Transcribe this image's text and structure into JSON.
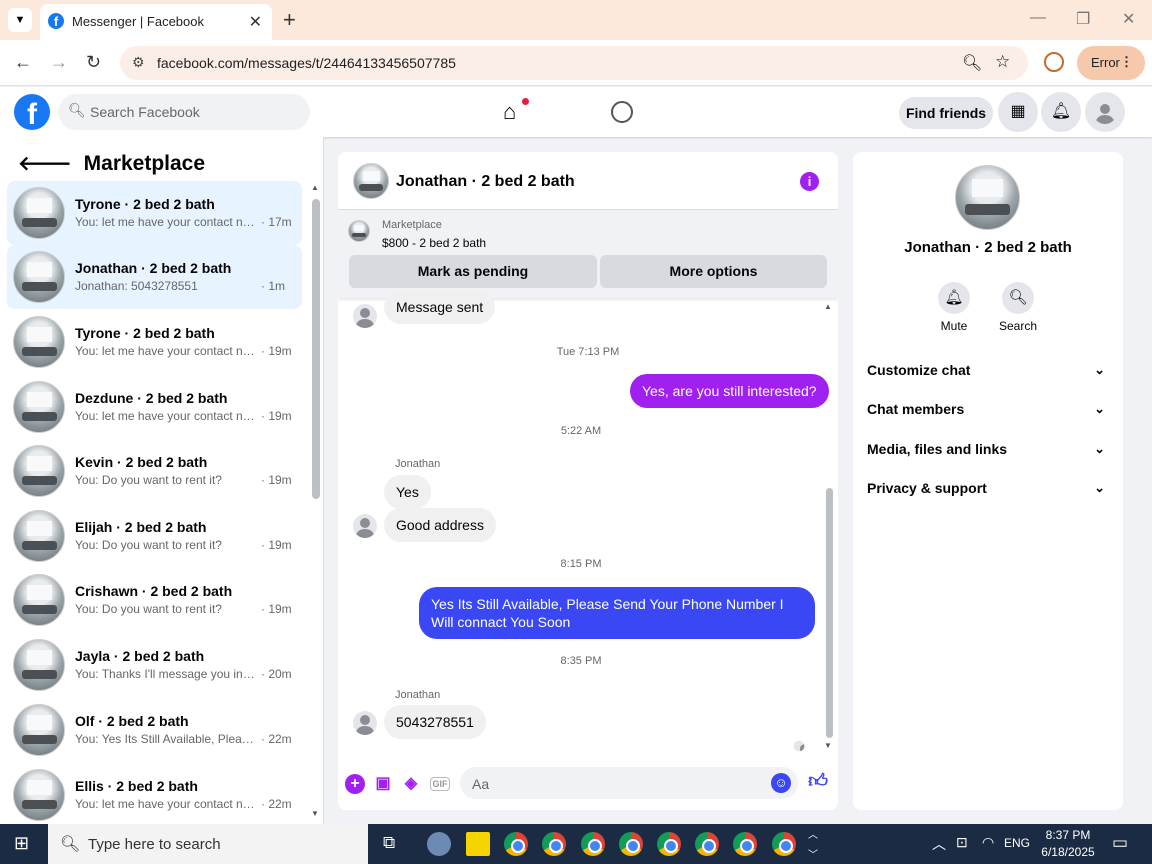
{
  "browser": {
    "tab_title": "Messenger | Facebook",
    "url": "facebook.com/messages/t/24464133456507785",
    "profile_button": "Error"
  },
  "facebook": {
    "search_placeholder": "Search Facebook",
    "find_friends": "Find friends"
  },
  "sidebar": {
    "title": "Marketplace",
    "conversations": [
      {
        "name": "Tyrone · 2 bed 2 bath",
        "snippet": "You: let me have your contact nu...",
        "time": "· 17m",
        "selected": true
      },
      {
        "name": "Jonathan · 2 bed 2 bath",
        "snippet": "Jonathan: 5043278551",
        "time": "· 1m",
        "selected": true
      },
      {
        "name": "Tyrone · 2 bed 2 bath",
        "snippet": "You: let me have your contact nu...",
        "time": "· 19m",
        "selected": false
      },
      {
        "name": "Dezdune · 2 bed 2 bath",
        "snippet": "You: let me have your contact nu...",
        "time": "· 19m",
        "selected": false
      },
      {
        "name": "Kevin · 2 bed 2 bath",
        "snippet": "You: Do you want to rent it?",
        "time": "· 19m",
        "selected": false
      },
      {
        "name": "Elijah · 2 bed 2 bath",
        "snippet": "You: Do you want to rent it?",
        "time": "· 19m",
        "selected": false
      },
      {
        "name": "Crishawn · 2 bed 2 bath",
        "snippet": "You: Do you want to rent it?",
        "time": "· 19m",
        "selected": false
      },
      {
        "name": "Jayla · 2 bed 2 bath",
        "snippet": "You: Thanks I'll message you in a ...",
        "time": "· 20m",
        "selected": false
      },
      {
        "name": "Olf · 2 bed 2 bath",
        "snippet": "You: Yes Its Still Available, Please ...",
        "time": "· 22m",
        "selected": false
      },
      {
        "name": "Ellis · 2 bed 2 bath",
        "snippet": "You: let me have your contact nu...",
        "time": "· 22m",
        "selected": false
      }
    ]
  },
  "chat": {
    "title": "Jonathan · 2 bed 2 bath",
    "marketplace_label": "Marketplace",
    "listing": "$800 - 2 bed 2 bath",
    "mark_pending": "Mark as pending",
    "more_options": "More options",
    "messages": {
      "m1": "Message sent",
      "ts1": "Tue 7:13 PM",
      "m2": "Yes, are you still interested?",
      "ts2": "5:22 AM",
      "sender1": "Jonathan",
      "m3": "Yes",
      "m4": "Good address",
      "ts3": "8:15 PM",
      "m5": "Yes Its Still Available, Please Send Your Phone Number I Will connact You Soon",
      "ts4": "8:35 PM",
      "sender2": "Jonathan",
      "m6": "5043278551"
    },
    "composer_placeholder": "Aa"
  },
  "details": {
    "name": "Jonathan · 2 bed 2 bath",
    "mute": "Mute",
    "search": "Search",
    "sections": [
      "Customize chat",
      "Chat members",
      "Media, files and links",
      "Privacy & support"
    ]
  },
  "taskbar": {
    "search_placeholder": "Type here to search",
    "lang": "ENG",
    "time": "8:37 PM",
    "date": "6/18/2025"
  },
  "colors": {
    "accent_purple": "#a020f0",
    "accent_blue": "#3a47f5",
    "fb_blue": "#1877f2"
  }
}
